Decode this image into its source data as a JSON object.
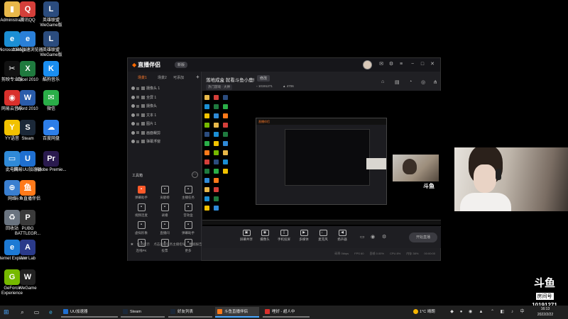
{
  "desktop_icons": [
    {
      "label": "Administra...",
      "icon": "folder-icon",
      "color": "#e8b84a",
      "glyph": "▮"
    },
    {
      "label": "腾讯QQ",
      "icon": "qq-icon",
      "color": "#d43f3a",
      "glyph": "Q"
    },
    {
      "label": "英雄联盟 WeGame版",
      "icon": "league-icon",
      "color": "#2b4c7e",
      "glyph": "L"
    },
    {
      "label": "Microsoft Edge",
      "icon": "edge-icon",
      "color": "#1b8fd4",
      "glyph": "e"
    },
    {
      "label": "2345加速浏览器",
      "icon": "browser-2345-icon",
      "color": "#2a7fd8",
      "glyph": "e"
    },
    {
      "label": "英雄联盟 WeGame版",
      "icon": "league-icon",
      "color": "#2b4c7e",
      "glyph": "L"
    },
    {
      "label": "剪映专业版",
      "icon": "jianying-icon",
      "color": "#111",
      "glyph": "✂"
    },
    {
      "label": "Excel 2010",
      "icon": "excel-icon",
      "color": "#1f7a3e",
      "glyph": "X"
    },
    {
      "label": "酷狗音乐",
      "icon": "kugou-icon",
      "color": "#1a8ef0",
      "glyph": "K"
    },
    {
      "label": "网易云音乐",
      "icon": "netease-music-icon",
      "color": "#d9302c",
      "glyph": "◉"
    },
    {
      "label": "Word 2010",
      "icon": "word-icon",
      "color": "#2a5caa",
      "glyph": "W"
    },
    {
      "label": "微信",
      "icon": "wechat-icon",
      "color": "#2aae48",
      "glyph": "✉"
    },
    {
      "label": "YY语音",
      "icon": "yy-icon",
      "color": "#f2c200",
      "glyph": "Y"
    },
    {
      "label": "Steam",
      "icon": "steam-icon",
      "color": "#1b2838",
      "glyph": "S"
    },
    {
      "label": "百度网盘",
      "icon": "baidu-netdisk-icon",
      "color": "#2d7ee8",
      "glyph": "☁"
    },
    {
      "label": "此电脑",
      "icon": "this-pc-icon",
      "color": "#2f8ad8",
      "glyph": "▭"
    },
    {
      "label": "网易UU加速器",
      "icon": "uu-icon",
      "color": "#1f6fd0",
      "glyph": "U"
    },
    {
      "label": "Adobe Premie...",
      "icon": "premiere-icon",
      "color": "#2a1a4e",
      "glyph": "Pr"
    },
    {
      "label": "网络",
      "icon": "network-icon",
      "color": "#3a7fd0",
      "glyph": "⊕"
    },
    {
      "label": "斗鱼直播伴侣",
      "icon": "douyu-companion-icon",
      "color": "#ff7a1a",
      "glyph": "鱼"
    },
    {
      "label": "回收站",
      "icon": "recycle-bin-icon",
      "color": "#6a7480",
      "glyph": "♻"
    },
    {
      "label": "PUBG BATTLEGR...",
      "icon": "pubg-icon",
      "color": "#3a3a3a",
      "glyph": "P"
    },
    {
      "label": "Internet Explorer",
      "icon": "ie-icon",
      "color": "#1d7ad4",
      "glyph": "e"
    },
    {
      "label": "Aim Lab",
      "icon": "aimlab-icon",
      "color": "#2a3a8a",
      "glyph": "A"
    },
    {
      "label": "GeForce Experience",
      "icon": "geforce-icon",
      "color": "#76b900",
      "glyph": "G"
    },
    {
      "label": "WeGame",
      "icon": "wegame-icon",
      "color": "#222",
      "glyph": "W"
    }
  ],
  "app": {
    "logo": "直播伴侣",
    "version_badge": "新版",
    "left_tabs": [
      "场景1",
      "场景2",
      "可添加"
    ],
    "sources": [
      "摄像头 1",
      "全屏 1",
      "摄像头",
      "文本 1",
      "图片 1",
      "画面裁剪",
      "弹幕浮窗"
    ],
    "tools_title": "工具箱",
    "tools": [
      {
        "label": "弹幕助手",
        "icon": "danmu-icon",
        "hot": true
      },
      {
        "label": "贡献榜",
        "icon": "rank-icon",
        "hot": false
      },
      {
        "label": "主播任务",
        "icon": "task-icon",
        "hot": false
      },
      {
        "label": "视频连麦",
        "icon": "video-link-icon",
        "hot": false
      },
      {
        "label": "录播",
        "icon": "record-icon",
        "hot": false
      },
      {
        "label": "音效盒",
        "icon": "sound-icon",
        "hot": false
      },
      {
        "label": "虚拟形象",
        "icon": "avatar-tool-icon",
        "hot": false
      },
      {
        "label": "直播间",
        "icon": "room-icon",
        "hot": false
      },
      {
        "label": "弹幕助手",
        "icon": "danmu-icon",
        "hot": false
      },
      {
        "label": "连线PK",
        "icon": "pk-icon",
        "hot": false
      },
      {
        "label": "投票",
        "icon": "vote-icon",
        "hot": false
      },
      {
        "label": "更多",
        "icon": "more-icon",
        "hot": false
      }
    ],
    "notice": [
      "任务提示",
      "点击查看任务主播指导",
      "数据报告"
    ],
    "room_title": "落地成盒 就看斗鱼小鹿!",
    "edit_label": "修改",
    "tag": "热门游戏 · 大神",
    "room_id": "10191271",
    "heat": "4706",
    "bottom_buttons": [
      {
        "label": "屏幕共享",
        "icon": "screen-share-icon"
      },
      {
        "label": "摄像头",
        "icon": "camera-icon"
      },
      {
        "label": "手机投屏",
        "icon": "phone-cast-icon"
      },
      {
        "label": "多媒体",
        "icon": "media-icon"
      },
      {
        "label": "麦克风",
        "icon": "mic-icon"
      },
      {
        "label": "扬声器",
        "icon": "speaker-icon"
      }
    ],
    "start_live": "开始直播",
    "stats": [
      "码率 0kbps",
      "FPS 60",
      "丢帧 0.00%",
      "CPU 8%",
      "内存 38%",
      "00:00:00"
    ]
  },
  "watermark": {
    "logo": "斗鱼",
    "sub": "房间号",
    "room_id": "10191271"
  },
  "taskbar": {
    "apps": [
      {
        "label": "UU加速器",
        "color": "#1f6fd0",
        "active": false
      },
      {
        "label": "Steam",
        "color": "#1b2838",
        "active": false
      },
      {
        "label": "好友列表",
        "color": "#1b2838",
        "active": false
      },
      {
        "label": "斗鱼直播伴侣",
        "color": "#ff7a1a",
        "active": true
      },
      {
        "label": "哩好 - 超人中",
        "color": "#d9302c",
        "active": false
      }
    ],
    "weather": "1°C 晴朗",
    "time": "16:13",
    "date": "2022/2/22"
  }
}
